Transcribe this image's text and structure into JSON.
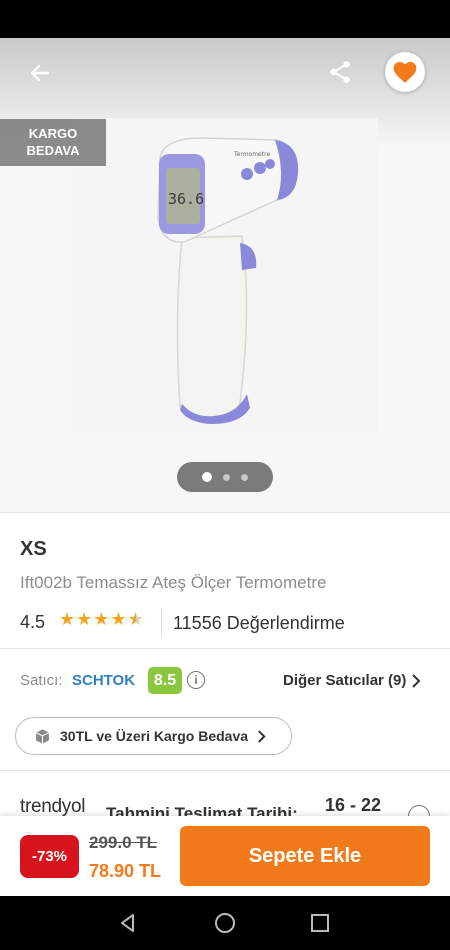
{
  "header": {
    "back_icon": "arrow-left-icon",
    "share_icon": "share-icon",
    "favorite_icon": "heart-icon",
    "accent_color": "#f27a1a"
  },
  "hero": {
    "badge": [
      "KARGO",
      "BEDAVA"
    ],
    "image_screen_text": "36.6",
    "image_label": "Termometre",
    "carousel_pages": 3,
    "carousel_active": 1
  },
  "product": {
    "brand": "XS",
    "title": "Ift002b Temassız Ateş Ölçer Termometre",
    "rating": "4.5",
    "stars_value": 4.5,
    "review_count": "11556 Değerlendirme"
  },
  "seller": {
    "label": "Satıcı:",
    "name": "SCHTOK",
    "score": "8.5",
    "score_color": "#8cc63f",
    "other_sellers": "Diğer Satıcılar (9)"
  },
  "shipping": {
    "free_cargo_text": "30TL ve Üzeri Kargo Bedava",
    "logo": "trendyol",
    "delivery_label": "Tahmini Teslimat Tarihi:",
    "delivery_dates": "16 - 22"
  },
  "purchase": {
    "discount": "-73%",
    "old_price": "299.0 TL",
    "new_price": "78.90 TL",
    "add_to_cart": "Sepete Ekle"
  },
  "system_nav": {
    "back": "nav-back-icon",
    "home": "nav-home-icon",
    "recents": "nav-recents-icon"
  }
}
